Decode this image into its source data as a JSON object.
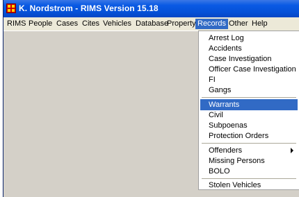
{
  "window": {
    "title": "K. Nordstrom - RIMS Version 15.18"
  },
  "menubar": {
    "items": [
      "RIMS",
      "People",
      "Cases",
      "Cites",
      "Vehicles",
      "Database",
      "Property",
      "Records",
      "Other",
      "Help"
    ],
    "active": "Records"
  },
  "records_menu": {
    "group1": [
      "Arrest Log",
      "Accidents",
      "Case Investigation",
      "Officer Case Investigation",
      "FI",
      "Gangs"
    ],
    "group2": [
      "Warrants",
      "Civil",
      "Subpoenas",
      "Protection Orders"
    ],
    "group3": [
      "Offenders",
      "Missing Persons",
      "BOLO"
    ],
    "group4": [
      "Stolen Vehicles"
    ],
    "selected": "Warrants",
    "submenu_item": "Offenders"
  },
  "colors": {
    "title_bar": "#0a5ae4",
    "menu_highlight": "#316ac5",
    "client_bg": "#d4d0c8"
  },
  "icons": {
    "app": "rims-app-icon",
    "submenu": "submenu-arrow-icon"
  }
}
